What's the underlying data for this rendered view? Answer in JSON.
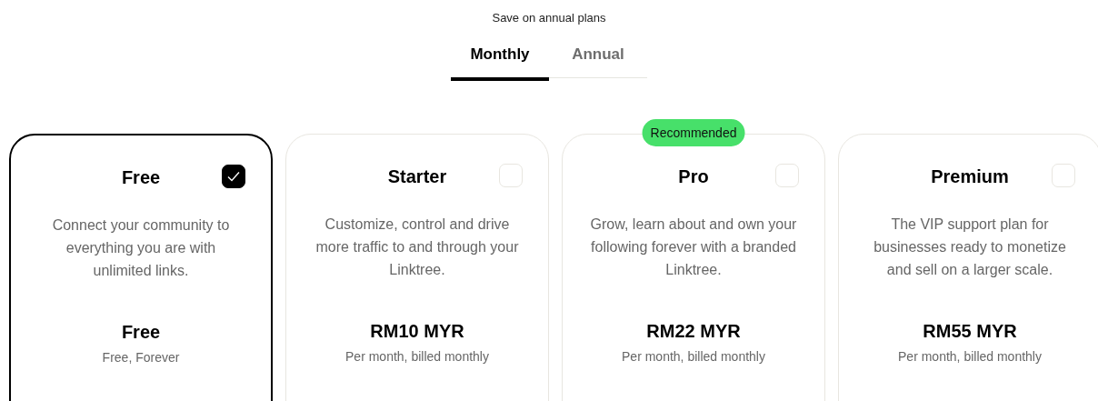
{
  "promo": "Save on annual plans",
  "tabs": [
    {
      "label": "Monthly",
      "selected": true
    },
    {
      "label": "Annual",
      "selected": false
    }
  ],
  "plans": [
    {
      "name": "Free",
      "selected": true,
      "description": "Connect your community to everything you are with unlimited links.",
      "price": "Free",
      "billing": "Free, Forever"
    },
    {
      "name": "Starter",
      "selected": false,
      "description": "Customize, control and drive more traffic to and through your Linktree.",
      "price": "RM10 MYR",
      "billing": "Per month, billed monthly"
    },
    {
      "name": "Pro",
      "selected": false,
      "badge": "Recommended",
      "description": "Grow, learn about and own your following forever with a branded Linktree.",
      "price": "RM22 MYR",
      "billing": "Per month, billed monthly"
    },
    {
      "name": "Premium",
      "selected": false,
      "description": "The VIP support plan for businesses ready to monetize and sell on a larger scale.",
      "price": "RM55 MYR",
      "billing": "Per month, billed monthly"
    }
  ]
}
